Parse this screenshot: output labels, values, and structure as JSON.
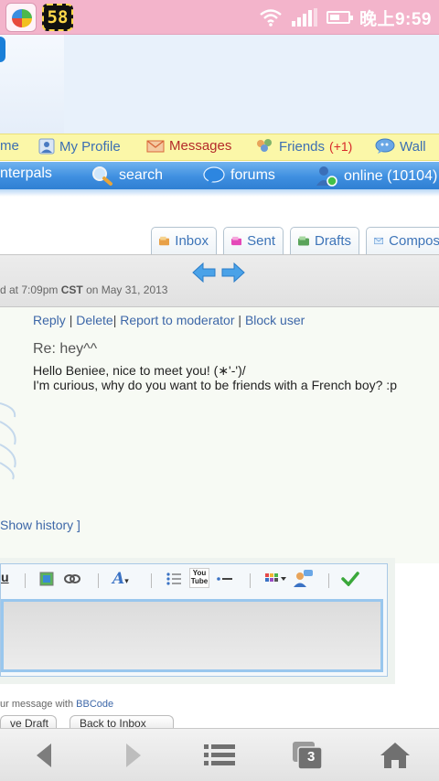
{
  "status_bar": {
    "counter": "58",
    "time": "晚上9:59",
    "icons": [
      "app-launcher-icon",
      "wifi-icon",
      "signal-icon",
      "battery-icon"
    ]
  },
  "nav_top": {
    "items": [
      {
        "label": "me",
        "icon": null
      },
      {
        "label": "My Profile",
        "icon": "profile-icon"
      },
      {
        "label": "Messages",
        "icon": "envelope-icon"
      },
      {
        "label": "Friends",
        "icon": "friends-icon",
        "badge": "(+1)"
      },
      {
        "label": "Wall",
        "icon": "speech-bubble-icon"
      }
    ]
  },
  "nav_main": {
    "items": [
      {
        "label": "nterpals",
        "icon": null
      },
      {
        "label": "search",
        "icon": "magnifier-icon"
      },
      {
        "label": "forums",
        "icon": "chat-bubble-icon"
      },
      {
        "label": "online (10104)",
        "icon": "online-user-icon"
      }
    ]
  },
  "mail_tabs": [
    {
      "label": "Inbox",
      "icon": "inbox-icon"
    },
    {
      "label": "Sent",
      "icon": "sent-icon"
    },
    {
      "label": "Drafts",
      "icon": "drafts-icon"
    },
    {
      "label": "Compos",
      "icon": "compose-icon"
    }
  ],
  "message": {
    "date_prefix": "d at 7:09pm",
    "tz": "CST",
    "date_suffix": "on May 31, 2013",
    "actions": {
      "reply": "Reply",
      "delete": "Delete",
      "report": "Report to moderator",
      "block": "Block user"
    },
    "subject": "Re: hey^^",
    "body_line1": "Hello Beniee, nice to meet you! (∗'-')/",
    "body_line2": "I'm curious, why do you want to be friends with a French boy? :p",
    "show_history": "Show history ]"
  },
  "editor": {
    "toolbar_icons": [
      "underline-icon",
      "image-icon",
      "link-icon",
      "font-color-icon",
      "list-icon",
      "youtube-icon",
      "horizontal-rule-icon",
      "color-palette-icon",
      "user-mention-icon",
      "check-icon"
    ],
    "youtube_text": "You Tube",
    "bbcode_prefix": "ur message with",
    "bbcode_link": "BBCode",
    "save_draft": "ve Draft",
    "back_to_inbox": "Back to Inbox"
  },
  "bottom_bar": {
    "icons": [
      "back-arrow-icon",
      "forward-arrow-icon",
      "menu-icon",
      "windows-icon",
      "home-icon"
    ],
    "windows_count": "3"
  },
  "colors": {
    "status_bar": "#f3b4cb",
    "nav_top_bg": "#fbf7a8",
    "nav_main_bg": "#3f8fe0",
    "link": "#3d67a8",
    "messages_label": "#b42a2a",
    "friends_badge": "#d8282a"
  }
}
